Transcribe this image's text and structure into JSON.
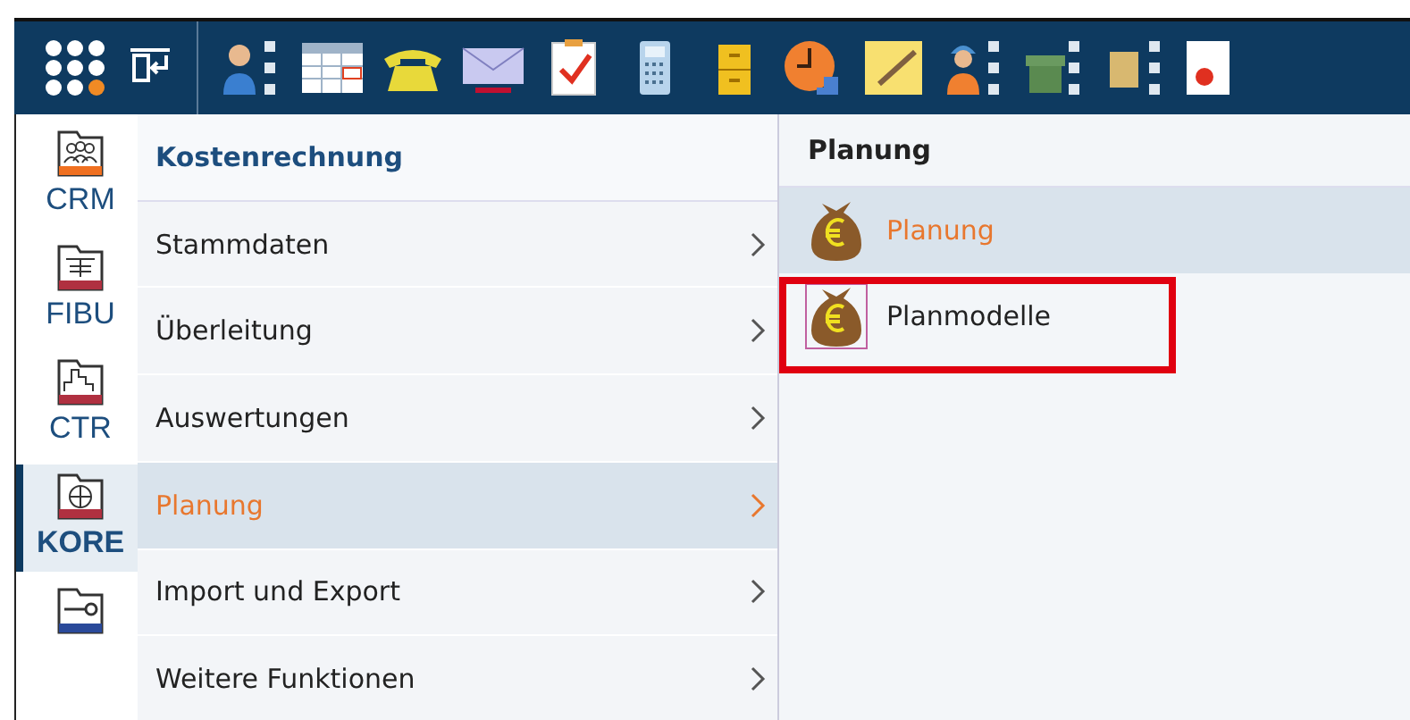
{
  "modules": [
    {
      "label": "CRM",
      "kind": "people",
      "selected": false
    },
    {
      "label": "FIBU",
      "kind": "ledger",
      "selected": false
    },
    {
      "label": "CTR",
      "kind": "chart",
      "selected": false
    },
    {
      "label": "KORE",
      "kind": "pie",
      "selected": true
    },
    {
      "kind": "key",
      "selected": false
    }
  ],
  "menu": {
    "title": "Kostenrechnung",
    "items": [
      {
        "label": "Stammdaten",
        "selected": false
      },
      {
        "label": "Überleitung",
        "selected": false
      },
      {
        "label": "Auswertungen",
        "selected": false
      },
      {
        "label": "Planung",
        "selected": true
      },
      {
        "label": "Import und Export",
        "selected": false
      },
      {
        "label": "Weitere Funktionen",
        "selected": false
      }
    ]
  },
  "submenu": {
    "title": "Planung",
    "items": [
      {
        "label": "Planung",
        "selected": true,
        "highlighted": false
      },
      {
        "label": "Planmodelle",
        "selected": false,
        "highlighted": true
      }
    ]
  }
}
